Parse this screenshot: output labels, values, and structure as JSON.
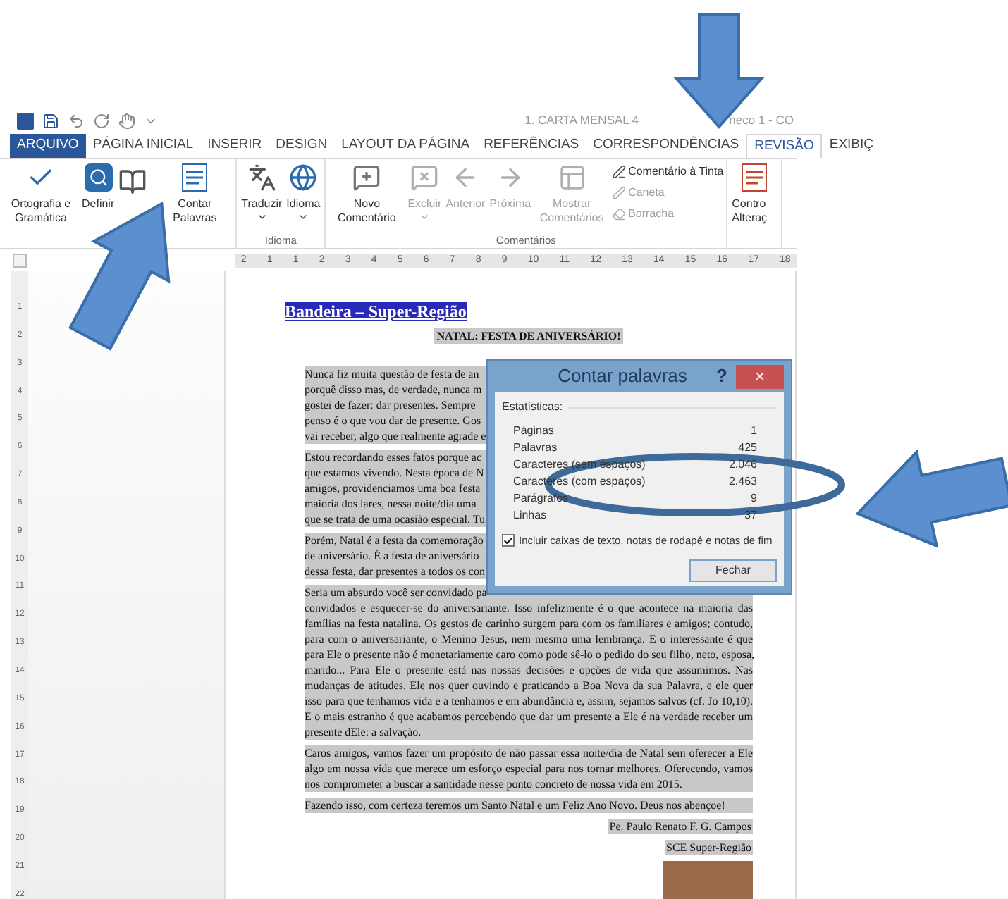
{
  "title_bar": {
    "title_parts": [
      "1. CARTA MENSAL 4",
      "neco 1 - CO"
    ]
  },
  "tabs": [
    {
      "label": "ARQUIVO",
      "kind": "file",
      "selected": false
    },
    {
      "label": "PÁGINA INICIAL",
      "kind": "tab",
      "selected": false
    },
    {
      "label": "INSERIR",
      "kind": "tab",
      "selected": false
    },
    {
      "label": "DESIGN",
      "kind": "tab",
      "selected": false
    },
    {
      "label": "LAYOUT DA PÁGINA",
      "kind": "tab",
      "selected": false
    },
    {
      "label": "REFERÊNCIAS",
      "kind": "tab",
      "selected": false
    },
    {
      "label": "CORRESPONDÊNCIAS",
      "kind": "tab",
      "selected": false
    },
    {
      "label": "REVISÃO",
      "kind": "tab",
      "selected": true
    },
    {
      "label": "EXIBIÇ",
      "kind": "tab",
      "selected": false
    }
  ],
  "ribbon": {
    "groups": [
      {
        "buttons": [
          {
            "kind": "large",
            "label": "Ortografia e Gramática",
            "disabled": false
          },
          {
            "kind": "large",
            "label": "Definir",
            "disabled": false
          },
          {
            "kind": "large",
            "disabled": false
          },
          {
            "kind": "large",
            "label": "Contar Palavras",
            "disabled": false
          }
        ]
      },
      {
        "label": "Idioma",
        "buttons": [
          {
            "kind": "large",
            "label": "Traduzir",
            "disabled": false,
            "dropdown": true
          },
          {
            "kind": "large",
            "label": "Idioma",
            "disabled": false,
            "dropdown": true
          }
        ]
      },
      {
        "label": "Comentários",
        "buttons": [
          {
            "kind": "large",
            "label": "Novo Comentário",
            "disabled": false
          },
          {
            "kind": "large",
            "label": "Excluir",
            "disabled": true,
            "dropdown": true
          },
          {
            "kind": "large",
            "label": "Anterior",
            "disabled": true
          },
          {
            "kind": "large",
            "label": "Próxima",
            "disabled": true
          },
          {
            "kind": "large",
            "label": "Mostrar Comentários",
            "disabled": true
          },
          {
            "kind": "stack",
            "items": [
              {
                "label": "Comentário à Tinta",
                "disabled": false
              },
              {
                "label": "Caneta",
                "disabled": true
              },
              {
                "label": "Borracha",
                "disabled": true
              }
            ]
          }
        ]
      },
      {
        "buttons": [
          {
            "kind": "large",
            "label": "Contro Alteraç",
            "disabled": false
          }
        ]
      }
    ]
  },
  "ruler": {
    "marks": [
      "2",
      "1",
      "1",
      "2",
      "3",
      "4",
      "5",
      "6",
      "7",
      "8",
      "9",
      "10",
      "11",
      "12",
      "13",
      "14",
      "15",
      "16",
      "17",
      "18"
    ],
    "vertical_marks": [
      "1",
      "2",
      "3",
      "4",
      "5",
      "6",
      "7",
      "8",
      "9",
      "10",
      "11",
      "12",
      "13",
      "14",
      "15",
      "16",
      "17",
      "18",
      "19",
      "20",
      "21",
      "22"
    ]
  },
  "document": {
    "heading": "Bandeira – Super-Região",
    "subtitle": "NATAL: FESTA DE ANIVERSÁRIO!",
    "covered_paragraphs": [
      [
        "Nunca fiz muita questão de festa de an",
        "porquê disso mas, de verdade, nunca m",
        "gostei de fazer: dar presentes. Sempre",
        "penso é o que vou dar de presente. Gos",
        "vai receber, algo que realmente agrade e"
      ],
      [
        "Estou recordando esses fatos porque ac",
        "que estamos vivendo. Nesta época de N",
        "amigos, providenciamos uma boa festa",
        "maioria dos lares, nessa noite/dia uma",
        "que se trata de uma ocasião especial. Tu"
      ],
      [
        "Porém, Natal é a festa da comemoração",
        "de aniversário. É a festa de aniversário",
        "dessa festa, dar presentes a todos os con"
      ]
    ],
    "paragraphs": [
      {
        "first_line": "Seria um absurdo você ser convidado pa",
        "lines": [
          "convidados e esquecer-se do aniversariante. Isso infelizmente é o que acontece na maioria das",
          "famílias na festa natalina. Os gestos de carinho surgem para com os familiares e amigos; contudo,",
          "para com o aniversariante, o Menino Jesus, nem mesmo uma lembrança. E o interessante é que",
          "para Ele o presente não é monetariamente caro como pode sê-lo o pedido do seu filho, neto, esposa,",
          "marido... Para Ele o presente está nas nossas decisões e opções de vida que assumimos. Nas",
          "mudanças de atitudes. Ele nos quer ouvindo e praticando a Boa Nova da sua Palavra, e ele quer",
          "isso para que tenhamos vida e a tenhamos e em abundância e, assim, sejamos salvos (cf. Jo 10,10).",
          "E o mais estranho é que acabamos percebendo que dar um presente a Ele é na verdade receber um",
          "presente dEle: a salvação."
        ]
      },
      {
        "lines": [
          "Caros amigos, vamos fazer um propósito de não passar essa noite/dia de Natal sem oferecer a Ele",
          "algo em nossa vida que merece um esforço especial para nos tornar melhores. Oferecendo, vamos",
          "nos comprometer a buscar a santidade nesse ponto concreto de nossa vida em 2015."
        ]
      },
      {
        "lines": [
          "Fazendo isso, com certeza teremos um Santo Natal e um Feliz Ano Novo. Deus nos abençoe!"
        ]
      }
    ],
    "signature": [
      "Pe. Paulo Renato F. G. Campos",
      "SCE Super-Região"
    ]
  },
  "dialog": {
    "title": "Contar palavras",
    "help": "?",
    "close": "×",
    "section": "Estatísticas:",
    "stats": [
      {
        "label": "Páginas",
        "value": "1"
      },
      {
        "label": "Palavras",
        "value": "425"
      },
      {
        "label": "Caracteres (sem espaços)",
        "value": "2.046"
      },
      {
        "label": "Caracteres (com espaços)",
        "value": "2.463"
      },
      {
        "label": "Parágrafos",
        "value": "9"
      },
      {
        "label": "Linhas",
        "value": "37"
      }
    ],
    "include": {
      "label": "Incluir caixas de texto, notas de rodapé e notas de fim",
      "checked": true
    },
    "button": "Fechar"
  }
}
